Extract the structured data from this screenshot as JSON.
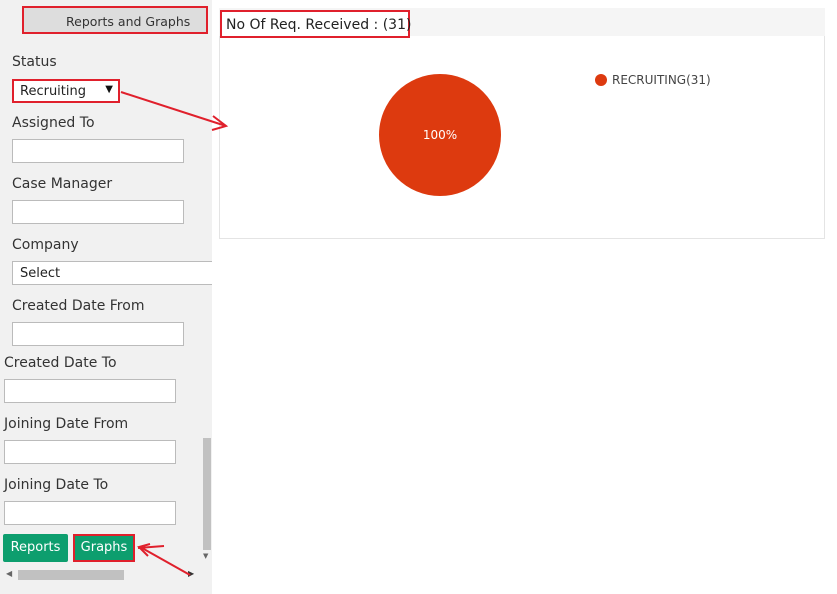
{
  "sidebar": {
    "header": "Reports and Graphs",
    "status": {
      "label": "Status",
      "value": "Recruiting"
    },
    "assigned_to": {
      "label": "Assigned To",
      "value": ""
    },
    "case_manager": {
      "label": "Case Manager",
      "value": ""
    },
    "company": {
      "label": "Company",
      "value": "Select"
    },
    "created_from": {
      "label": "Created Date From",
      "value": ""
    },
    "created_to": {
      "label": "Created Date To",
      "value": ""
    },
    "joining_from": {
      "label": "Joining Date From",
      "value": ""
    },
    "joining_to": {
      "label": "Joining Date To",
      "value": ""
    },
    "buttons": {
      "reports": "Reports",
      "graphs": "Graphs"
    }
  },
  "chart_panel": {
    "title": "No Of Req. Received : (31)"
  },
  "chart_data": {
    "type": "pie",
    "title": "No Of Req. Received : (31)",
    "slices": [
      {
        "label": "RECRUITING(31)",
        "value": 31,
        "percent_label": "100%",
        "color": "#dd3a0f"
      }
    ],
    "legend_position": "top-right"
  },
  "colors": {
    "button_green": "#0d9e6e",
    "annotation_red": "#e0202c",
    "pie_red": "#dd3a0f"
  }
}
